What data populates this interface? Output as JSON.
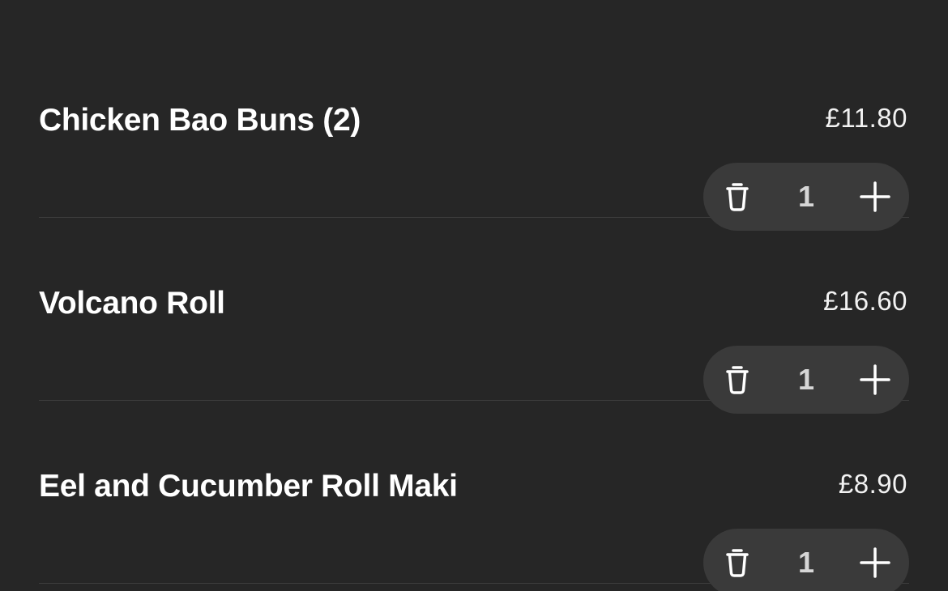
{
  "basket": {
    "items": [
      {
        "name": "Chicken Bao Buns (2)",
        "price": "£11.80",
        "quantity": "1",
        "remove_icon": "trash-icon",
        "add_icon": "plus-icon"
      },
      {
        "name": "Volcano Roll",
        "price": "£16.60",
        "quantity": "1",
        "remove_icon": "trash-icon",
        "add_icon": "plus-icon"
      },
      {
        "name": "Eel and Cucumber Roll Maki",
        "price": "£8.90",
        "quantity": "1",
        "remove_icon": "trash-icon",
        "add_icon": "plus-icon"
      }
    ]
  },
  "colors": {
    "background": "#262626",
    "stepper_background": "#3a3a3a",
    "divider": "#3e3e3e",
    "text": "#ffffff"
  }
}
